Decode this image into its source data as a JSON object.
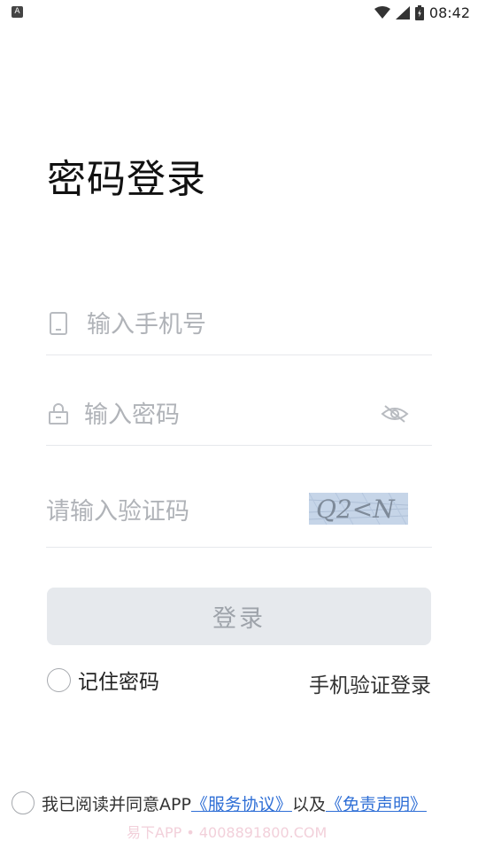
{
  "status_bar": {
    "app_icon_letter": "A",
    "time": "08:42"
  },
  "page": {
    "title": "密码登录"
  },
  "form": {
    "phone_placeholder": "输入手机号",
    "password_placeholder": "输入密码",
    "captcha_placeholder": "请输入验证码",
    "captcha_image_text": "Q2<N"
  },
  "actions": {
    "login_label": "登录",
    "remember_label": "记住密码",
    "sms_login_label": "手机验证登录"
  },
  "agreement": {
    "prefix": "我已阅读并同意APP",
    "service_link": "《服务协议》",
    "conjunction": "以及",
    "disclaimer_link": "《免责声明》"
  },
  "watermark": "易下APP • 4008891800.COM",
  "colors": {
    "link": "#2f6fd6",
    "button_disabled_bg": "#e6e9ed",
    "button_disabled_text": "#9ea3aa"
  }
}
